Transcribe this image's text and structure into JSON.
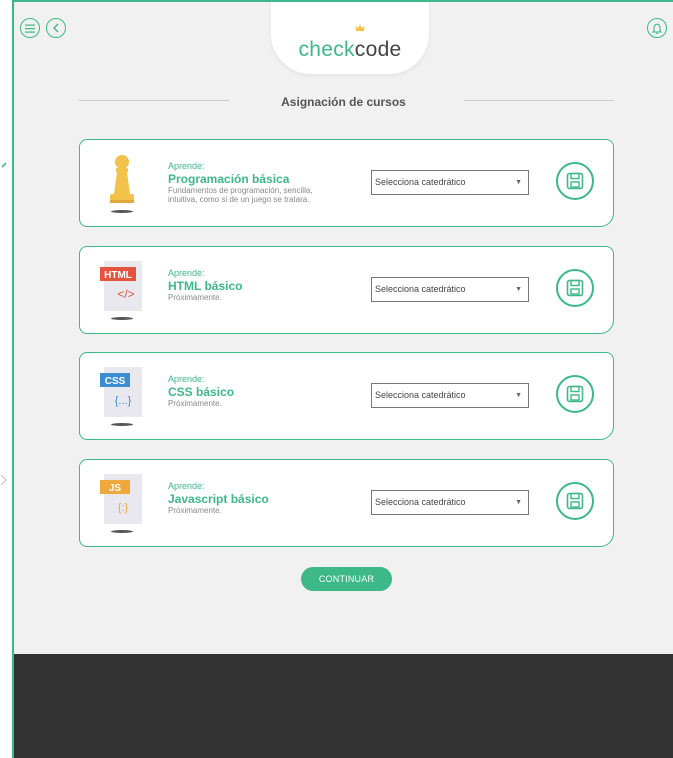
{
  "header": {
    "logo_check": "check",
    "logo_code": "code",
    "menu_icon": "menu-icon",
    "back_icon": "back-icon",
    "bell_icon": "bell-icon"
  },
  "section_title": "Asignación de cursos",
  "courses": [
    {
      "icon": "pawn-icon",
      "icon_label": "",
      "icon_code": "",
      "aprende": "Aprende:",
      "title": "Programación básica",
      "description": "Fundamentos de programación, sencilla, intuitiva, como si de un juego se tratara.",
      "select_value": "Selecciona catedrático"
    },
    {
      "icon": "html-file-icon",
      "icon_label": "HTML",
      "icon_code": "</>",
      "aprende": "Aprende:",
      "title": "HTML básico",
      "description": "Próximamente.",
      "select_value": "Selecciona catedrático"
    },
    {
      "icon": "css-file-icon",
      "icon_label": "CSS",
      "icon_code": "{...}",
      "aprende": "Aprende:",
      "title": "CSS básico",
      "description": "Próximamente.",
      "select_value": "Selecciona catedrático"
    },
    {
      "icon": "js-file-icon",
      "icon_label": "JS",
      "icon_code": "{:}",
      "aprende": "Aprende:",
      "title": "Javascript básico",
      "description": "Próximamente.",
      "select_value": "Selecciona catedrático"
    }
  ],
  "continue_label": "CONTINUAR",
  "colors": {
    "accent": "#3cb889",
    "background": "#f1f1f1",
    "footer": "#333334",
    "html_badge": "#e5533d",
    "css_badge": "#3b8fd1",
    "js_badge": "#efa83b",
    "pawn": "#f3c24a"
  }
}
